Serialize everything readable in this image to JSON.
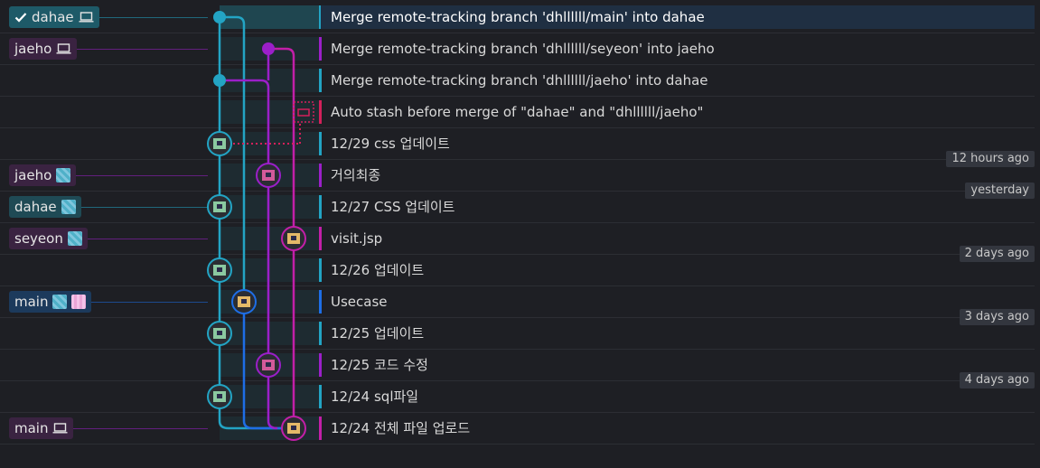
{
  "colors": {
    "teal": "#23a4c4",
    "blue": "#1e6ee6",
    "purple": "#9b1fc9",
    "magenta": "#c21fa8",
    "stash": "#d4205a"
  },
  "refs": [
    {
      "label": "dahae",
      "style": "teal active",
      "row": 0,
      "icons": [
        "check-icon",
        "laptop-icon"
      ]
    },
    {
      "label": "jaeho",
      "style": "purple",
      "row": 1,
      "icons": [
        "laptop-icon"
      ]
    },
    {
      "label": "jaeho",
      "style": "purple",
      "row": 5,
      "icons": [
        "remote-avatar-icon"
      ]
    },
    {
      "label": "dahae",
      "style": "teal",
      "row": 6,
      "icons": [
        "remote-avatar-icon"
      ]
    },
    {
      "label": "seyeon",
      "style": "purple",
      "row": 7,
      "icons": [
        "remote-avatar-icon"
      ]
    },
    {
      "label": "main",
      "style": "blue",
      "row": 9,
      "icons": [
        "remote-avatar-icon",
        "remote-avatar-icon-2"
      ]
    },
    {
      "label": "main",
      "style": "purple",
      "row": 13,
      "icons": [
        "laptop-icon"
      ]
    }
  ],
  "commits": [
    {
      "message": "Merge remote-tracking branch 'dhllllll/main' into dahae",
      "lane": "teal",
      "selected": true
    },
    {
      "message": "Merge remote-tracking branch 'dhllllll/seyeon' into jaeho",
      "lane": "purple"
    },
    {
      "message": "Merge remote-tracking branch 'dhllllll/jaeho' into dahae",
      "lane": "teal"
    },
    {
      "message": "Auto stash before merge of \"dahae\" and \"dhllllll/jaeho\"",
      "lane": "stash"
    },
    {
      "message": "12/29 css 업데이트",
      "lane": "teal"
    },
    {
      "message": "거의최종",
      "lane": "purple"
    },
    {
      "message": "12/27 CSS 업데이트",
      "lane": "teal"
    },
    {
      "message": "visit.jsp",
      "lane": "magenta"
    },
    {
      "message": "12/26 업데이트",
      "lane": "teal"
    },
    {
      "message": "Usecase",
      "lane": "blue"
    },
    {
      "message": "12/25 업데이트",
      "lane": "teal"
    },
    {
      "message": "12/25 코드 수정",
      "lane": "purple"
    },
    {
      "message": "12/24 sql파일",
      "lane": "teal"
    },
    {
      "message": "12/24 전체 파일 업로드",
      "lane": "magenta"
    }
  ],
  "time_labels": [
    {
      "text": "12 hours ago",
      "after_row": 4
    },
    {
      "text": "yesterday",
      "after_row": 5
    },
    {
      "text": "2 days ago",
      "after_row": 7
    },
    {
      "text": "3 days ago",
      "after_row": 9
    },
    {
      "text": "4 days ago",
      "after_row": 11
    }
  ]
}
